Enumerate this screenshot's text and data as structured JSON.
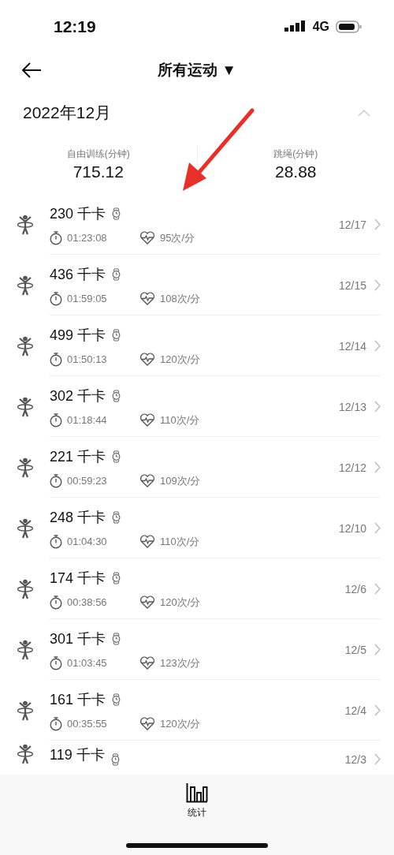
{
  "status_bar": {
    "time": "12:19",
    "network": "4G"
  },
  "header": {
    "title": "所有运动",
    "dropdown_glyph": "▼"
  },
  "month": {
    "label": "2022年12月",
    "expanded": true
  },
  "summary": [
    {
      "label": "自由训练(分钟)",
      "value": "715.12"
    },
    {
      "label": "跳绳(分钟)",
      "value": "28.88"
    }
  ],
  "records": [
    {
      "calories": "230 千卡",
      "duration": "01:23:08",
      "heart_rate": "95次/分",
      "date": "12/17"
    },
    {
      "calories": "436 千卡",
      "duration": "01:59:05",
      "heart_rate": "108次/分",
      "date": "12/15"
    },
    {
      "calories": "499 千卡",
      "duration": "01:50:13",
      "heart_rate": "120次/分",
      "date": "12/14"
    },
    {
      "calories": "302 千卡",
      "duration": "01:18:44",
      "heart_rate": "110次/分",
      "date": "12/13"
    },
    {
      "calories": "221 千卡",
      "duration": "00:59:23",
      "heart_rate": "109次/分",
      "date": "12/12"
    },
    {
      "calories": "248 千卡",
      "duration": "01:04:30",
      "heart_rate": "110次/分",
      "date": "12/10"
    },
    {
      "calories": "174 千卡",
      "duration": "00:38:56",
      "heart_rate": "120次/分",
      "date": "12/6"
    },
    {
      "calories": "301 千卡",
      "duration": "01:03:45",
      "heart_rate": "123次/分",
      "date": "12/5"
    },
    {
      "calories": "161 千卡",
      "duration": "00:35:55",
      "heart_rate": "120次/分",
      "date": "12/4"
    },
    {
      "calories": "119 千卡",
      "date": "12/3"
    }
  ],
  "tab_bar": [
    {
      "label": "统计",
      "selected": true
    }
  ]
}
